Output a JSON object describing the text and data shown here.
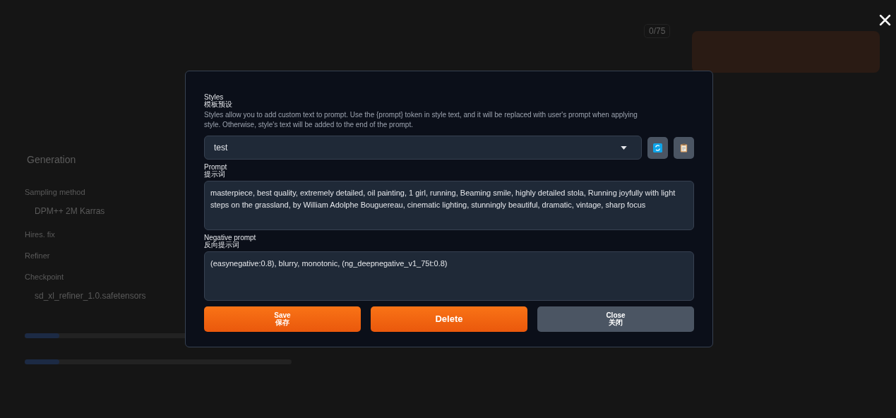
{
  "background": {
    "counter": "0/75",
    "tab": "Generation",
    "fields": [
      {
        "label": "Sampling method",
        "value": "DPM++ 2M Karras"
      },
      {
        "label": "Hires. fix"
      },
      {
        "label": "Refiner"
      },
      {
        "label": "Checkpoint",
        "value": "sd_xl_refiner_1.0.safetensors"
      }
    ],
    "sliders": [
      {
        "level": 0.13
      },
      {
        "level": 0.13
      }
    ]
  },
  "modal": {
    "styles": {
      "label": "Styles",
      "label_cn": "模板预设",
      "description": "Styles allow you to add custom text to prompt. Use the {prompt} token in style text, and it will be replaced with user's prompt when applying style. Otherwise, style's text will be added to the end of the prompt.",
      "value": "test"
    },
    "prompt": {
      "label": "Prompt",
      "label_cn": "提示词",
      "value": "masterpiece, best quality, extremely detailed, oil painting, 1 girl, running, Beaming smile, highly detailed stola, Running joyfully with light steps on the grassland, by William Adolphe Bouguereau, cinematic lighting, stunningly beautiful, dramatic, vintage, sharp focus"
    },
    "negative_prompt": {
      "label": "Negative prompt",
      "label_cn": "反向提示词",
      "value": "(easynegative:0.8), blurry, monotonic,  (ng_deepnegative_v1_75t:0.8)"
    },
    "buttons": [
      {
        "label": "Save",
        "label_cn": "保存",
        "kind": "primary"
      },
      {
        "label": "Delete",
        "kind": "primary"
      },
      {
        "label": "Close",
        "label_cn": "关闭",
        "kind": "secondary"
      }
    ]
  }
}
